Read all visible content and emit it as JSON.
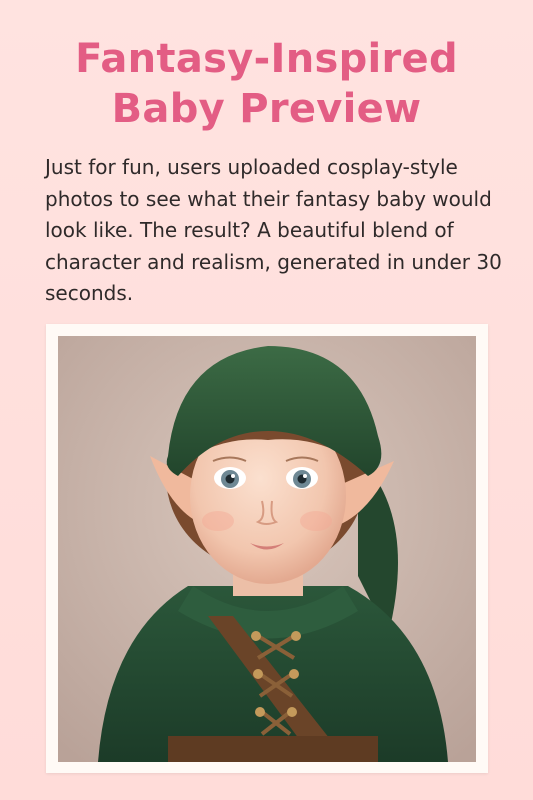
{
  "title": {
    "line1": "Fantasy-Inspired",
    "line2": "Baby Preview"
  },
  "description": "Just for fun, users uploaded cosplay-style photos to see what their fantasy baby would look like. The result? A beautiful blend of character and realism, generated in under 30 seconds.",
  "colors": {
    "background": "#ffe0de",
    "title": "#e35d84",
    "body_text": "#2f2a2a",
    "frame": "#fffaf6",
    "costume_green": "#2f5a3a"
  },
  "image": {
    "subject": "baby-elf-costume-photo"
  }
}
